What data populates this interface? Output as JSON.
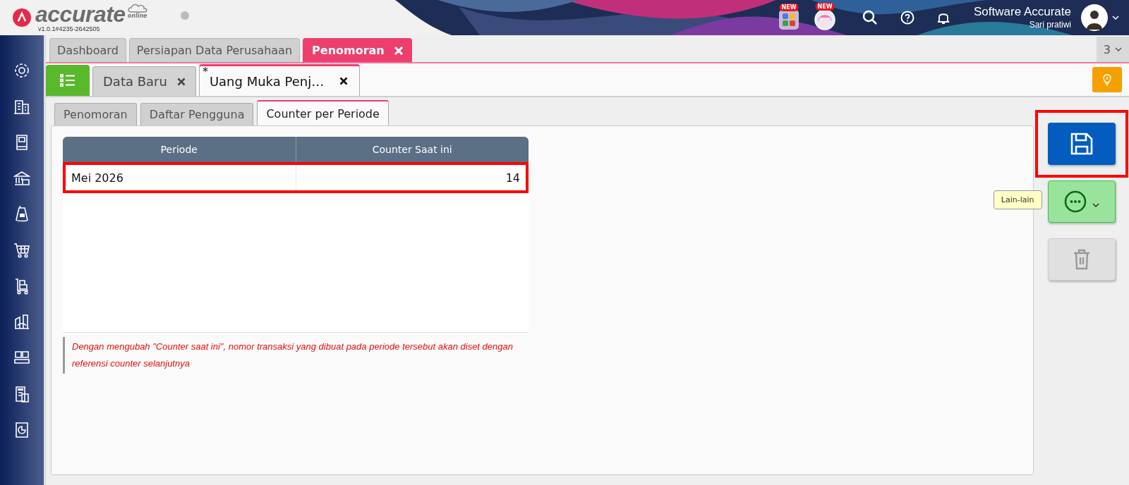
{
  "header": {
    "brand": "accurate",
    "brand_sub": "online",
    "version": "v1.0.1#4235-2642505",
    "apps": [
      {
        "badge": "NEW",
        "kind": "apps"
      },
      {
        "badge": "NEW",
        "kind": "assistant"
      }
    ],
    "company": "Software Accurate",
    "user": "Sari pratiwi"
  },
  "main_tabs": [
    {
      "label": "Dashboard",
      "selected": false,
      "closable": false
    },
    {
      "label": "Persiapan Data Perusahaan",
      "selected": false,
      "closable": false
    },
    {
      "label": "Penomoran",
      "selected": true,
      "closable": true
    }
  ],
  "tab_count": "3",
  "doc_tabs": [
    {
      "label": "Data Baru",
      "selected": false
    },
    {
      "label": "Uang Muka Penj…",
      "selected": true,
      "marker": "*"
    }
  ],
  "sub_tabs": [
    {
      "label": "Penomoran",
      "selected": false
    },
    {
      "label": "Daftar Pengguna",
      "selected": false
    },
    {
      "label": "Counter per Periode",
      "selected": true
    }
  ],
  "table": {
    "columns": [
      "Periode",
      "Counter Saat ini"
    ],
    "rows": [
      {
        "cells": [
          "Mei 2026",
          "14"
        ],
        "highlighted": true
      }
    ]
  },
  "note": "Dengan mengubah \"Counter saat ini\", nomor transaksi yang dibuat pada periode tersebut akan diset dengan referensi counter selanjutnya",
  "actions": [
    {
      "kind": "save",
      "highlighted": true,
      "disabled": false
    },
    {
      "kind": "more",
      "tooltip": "Lain-lain",
      "highlighted": false,
      "disabled": false
    },
    {
      "kind": "delete",
      "highlighted": false,
      "disabled": true
    }
  ]
}
